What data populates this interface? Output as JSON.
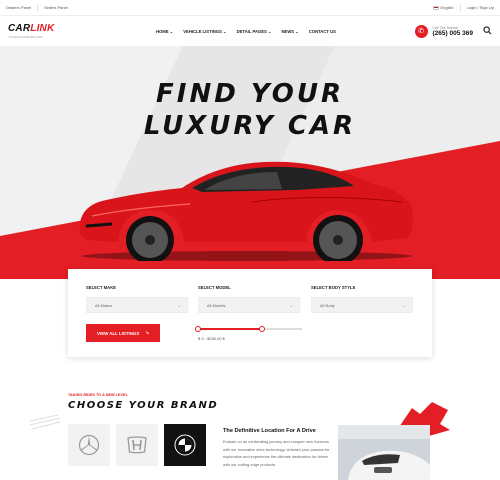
{
  "topbar": {
    "dealers_panel": "Dealers Panel",
    "sellers_panel": "Sellers Panel",
    "language": "English",
    "login": "Login / Sign Up"
  },
  "header": {
    "logo_left": "CAR",
    "logo_right": "LINK",
    "logo_tagline": "YOUR CLASSIFIED SITE",
    "nav": [
      {
        "label": "HOME",
        "has_dropdown": true
      },
      {
        "label": "VEHICLE LISTINGS",
        "has_dropdown": true
      },
      {
        "label": "DETAIL PAGES",
        "has_dropdown": true
      },
      {
        "label": "NEWS",
        "has_dropdown": true
      },
      {
        "label": "CONTACT US",
        "has_dropdown": false
      }
    ],
    "hotline_label": "Call Our Hotline",
    "hotline_number": "(265) 005 369",
    "search_icon": "search-icon",
    "phone_icon": "phone-icon"
  },
  "hero": {
    "title_line1": "FIND YOUR",
    "title_line2": "LUXURY CAR"
  },
  "search_panel": {
    "make_label": "SELECT MAKE",
    "make_value": "All Makes",
    "model_label": "SELECT MODEL",
    "model_value": "All Models",
    "body_label": "SELECT BODY STYLE",
    "body_value": "All Body",
    "button_label": "VIEW ALL LISTINGS",
    "price_range": "$ 0 - $250,00 $",
    "price_min_fraction": 0.0,
    "price_max_fraction": 0.62
  },
  "brands": {
    "tagline": "TAKING RIDES TO A NEW LEVEL",
    "title": "CHOOSE YOUR BRAND",
    "items": [
      "mercedes-logo",
      "honda-logo",
      "bmw-logo"
    ],
    "active_index": 2
  },
  "promo": {
    "title": "The Definitive Location For A Drive",
    "text": "Embark on an exhilarating journey and conquer new horizons with our innovative drive technology. Unleash your passion for exploration and experience the ultimate destination for drives with our cutting-edge products."
  },
  "colors": {
    "accent": "#e31e24",
    "dark": "#111111",
    "light_bg": "#f2f2f2"
  }
}
